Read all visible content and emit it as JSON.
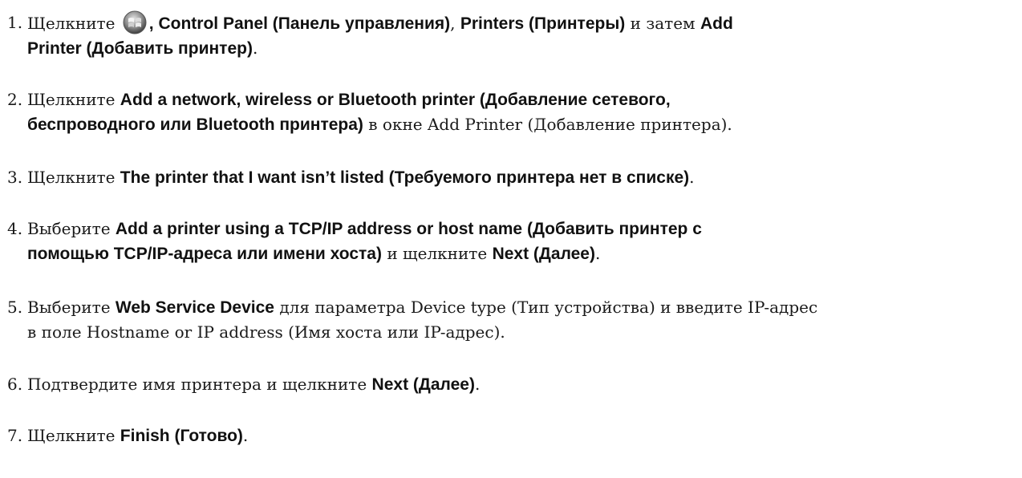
{
  "steps": [
    {
      "number": "1.",
      "t1": "Щелкните",
      "icon": "windows-start-icon",
      "b1": ", Control Panel (Панель управления)",
      "t2": ",",
      "b2": "Printers (Принтеры)",
      "t3": " и затем",
      "b3": "Add",
      "b4": "Printer (Добавить принтер)",
      "t4": "."
    },
    {
      "number": "2.",
      "t1": "Щелкните",
      "b1": "Add a network, wireless or Bluetooth printer (Добавление сетевого,",
      "b2": "беспроводного или Bluetooth принтера)",
      "t2": " в окне Add Printer (Добавление принтера)."
    },
    {
      "number": "3.",
      "t1": "Щелкните",
      "b1": "The printer that I want isn’t listed (Требуемого принтера нет в списке)",
      "t2": "."
    },
    {
      "number": "4.",
      "t1": "Выберите",
      "b1": "Add a printer using a TCP/IP address or host name (Добавить принтер с",
      "b2": "помощью TCP/IP-адреса или имени хоста)",
      "t2": " и щелкните",
      "b3": "Next (Далее)",
      "t3": "."
    },
    {
      "number": "5.",
      "t1": "Выберите",
      "b1": "Web Service Device",
      "t2": " для параметра Device type (Тип устройства) и введите IP-адрес",
      "t3": "в поле Hostname or IP address (Имя хоста или IP-адрес)."
    },
    {
      "number": "6.",
      "t1": "Подтвердите имя принтера и щелкните",
      "b1": "Next (Далее)",
      "t2": "."
    },
    {
      "number": "7.",
      "t1": "Щелкните",
      "b1": "Finish (Готово)",
      "t2": "."
    }
  ]
}
